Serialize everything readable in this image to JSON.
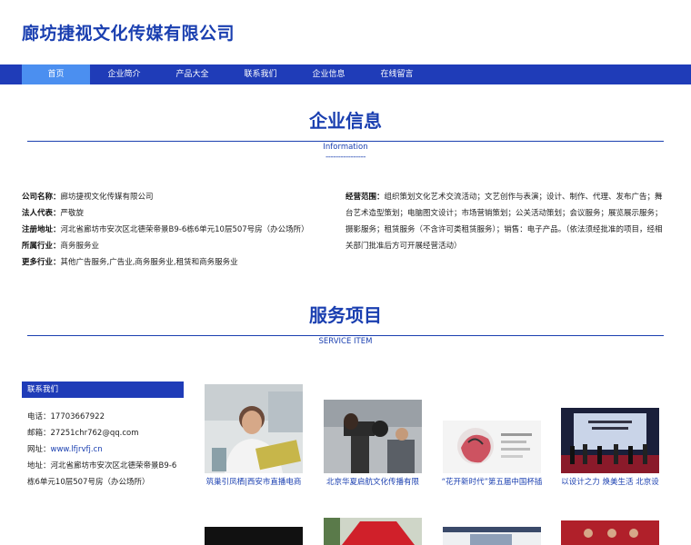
{
  "site_title": "廊坊捷视文化传媒有限公司",
  "nav": [
    "首页",
    "企业简介",
    "产品大全",
    "联系我们",
    "企业信息",
    "在线留言"
  ],
  "section_info": {
    "title": "企业信息",
    "subtitle": "Information",
    "dashes": "----------------"
  },
  "company": {
    "name_label": "公司名称：",
    "name": "廊坊捷视文化传媒有限公司",
    "rep_label": "法人代表：",
    "rep": "严敬旋",
    "addr_label": "注册地址：",
    "addr": "河北省廊坊市安次区北德荣帝景B9-6栋6单元10层507号房（办公场所）",
    "industry_label": "所属行业：",
    "industry": "商务服务业",
    "more_label": "更多行业：",
    "more": "其他广告服务,广告业,商务服务业,租赁和商务服务业",
    "scope_label": "经营范围：",
    "scope": "组织策划文化艺术交流活动；文艺创作与表演；设计、制作、代理、发布广告；舞台艺术造型策划；电脑图文设计；市场营销策划；公关活动策划；会议服务；展览展示服务；摄影服务；租赁服务（不含许可类租赁服务）；销售：电子产品。（依法须经批准的项目，经相关部门批准后方可开展经营活动）"
  },
  "section_service": {
    "title": "服务项目",
    "subtitle": "SERVICE ITEM"
  },
  "contact": {
    "heading": "联系我们",
    "phone_label": "电话：",
    "phone": "17703667922",
    "email_label": "邮箱：",
    "email": "27251chr762@qq.com",
    "web_label": "网址：",
    "web": "www.lfjrvfj.cn",
    "addr_label": "地址：",
    "addr": "河北省廊坊市安次区北德荣帝景B9-6栋6单元10层507号房（办公场所）"
  },
  "services": [
    {
      "caption": "筑巢引凤栖|西安市直播电商"
    },
    {
      "caption": "北京华夏启航文化传播有限"
    },
    {
      "caption": "“花开新时代”第五届中国杯插"
    },
    {
      "caption": "以设计之力 焕美生活 北京设"
    }
  ]
}
